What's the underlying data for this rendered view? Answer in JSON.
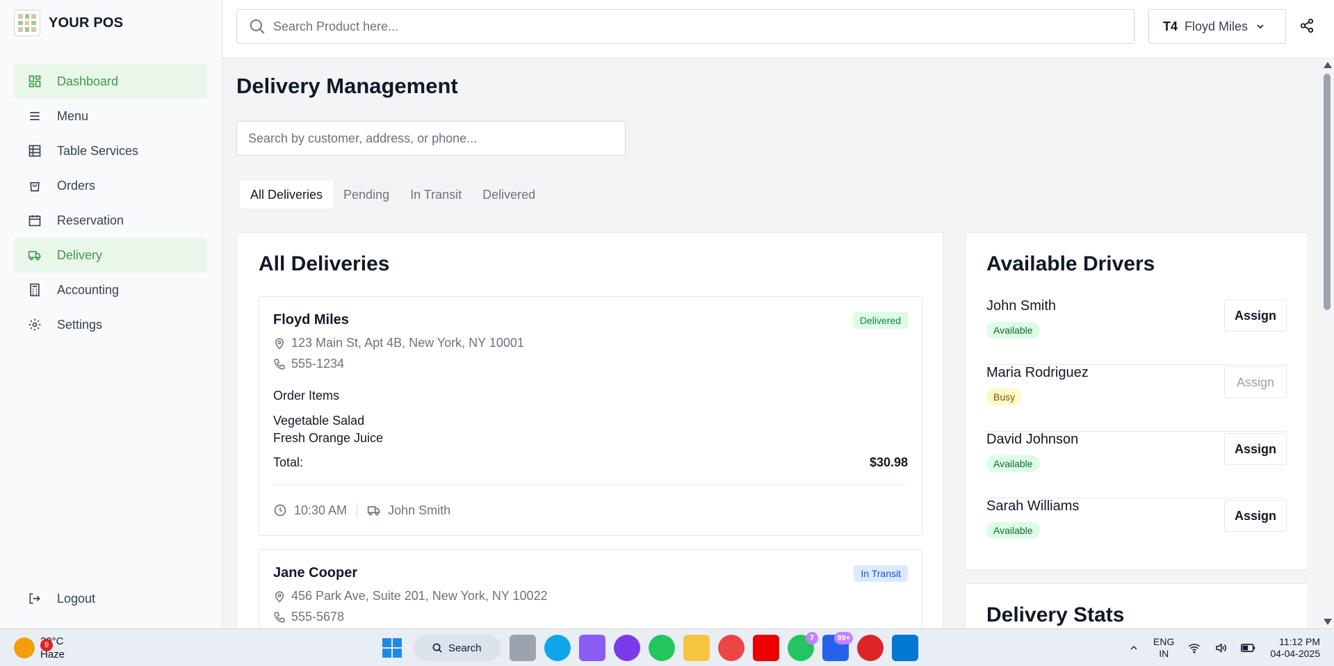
{
  "app": {
    "name": "YOUR POS"
  },
  "sidebar": {
    "items": [
      {
        "label": "Dashboard",
        "icon": "dashboard-icon"
      },
      {
        "label": "Menu",
        "icon": "menu-icon"
      },
      {
        "label": "Table Services",
        "icon": "table-icon"
      },
      {
        "label": "Orders",
        "icon": "bag-icon"
      },
      {
        "label": "Reservation",
        "icon": "calendar-icon"
      },
      {
        "label": "Delivery",
        "icon": "truck-icon"
      },
      {
        "label": "Accounting",
        "icon": "calculator-icon"
      },
      {
        "label": "Settings",
        "icon": "gear-icon"
      }
    ],
    "logout": "Logout"
  },
  "header": {
    "search_placeholder": "Search Product here...",
    "table_code": "T4",
    "customer": "Floyd Miles"
  },
  "page": {
    "title": "Delivery Management",
    "filter_placeholder": "Search by customer, address, or phone...",
    "tabs": [
      "All Deliveries",
      "Pending",
      "In Transit",
      "Delivered"
    ]
  },
  "deliveries": {
    "title": "All Deliveries",
    "order_items_label": "Order Items",
    "total_label": "Total:",
    "cards": [
      {
        "name": "Floyd Miles",
        "status": "Delivered",
        "address": "123 Main St, Apt 4B, New York, NY 10001",
        "phone": "555-1234",
        "items": [
          "Vegetable Salad",
          "Fresh Orange Juice"
        ],
        "total": "$30.98",
        "time": "10:30 AM",
        "driver": "John Smith"
      },
      {
        "name": "Jane Cooper",
        "status": "In Transit",
        "address": "456 Park Ave, Suite 201, New York, NY 10022",
        "phone": "555-5678"
      }
    ]
  },
  "drivers": {
    "title": "Available Drivers",
    "assign_label": "Assign",
    "list": [
      {
        "name": "John Smith",
        "status": "Available"
      },
      {
        "name": "Maria Rodriguez",
        "status": "Busy"
      },
      {
        "name": "David Johnson",
        "status": "Available"
      },
      {
        "name": "Sarah Williams",
        "status": "Available"
      }
    ]
  },
  "stats": {
    "title": "Delivery Stats"
  },
  "taskbar": {
    "weather_alerts": "9",
    "temperature": "29°C",
    "condition": "Haze",
    "search_label": "Search",
    "whatsapp_badge": "7",
    "outlook_badge": "99+",
    "lang_top": "ENG",
    "lang_bottom": "IN",
    "time": "11:12 PM",
    "date": "04-04-2025"
  },
  "colors": {
    "accent": "#3f9b45",
    "accent_bg": "#e8f7ea"
  }
}
